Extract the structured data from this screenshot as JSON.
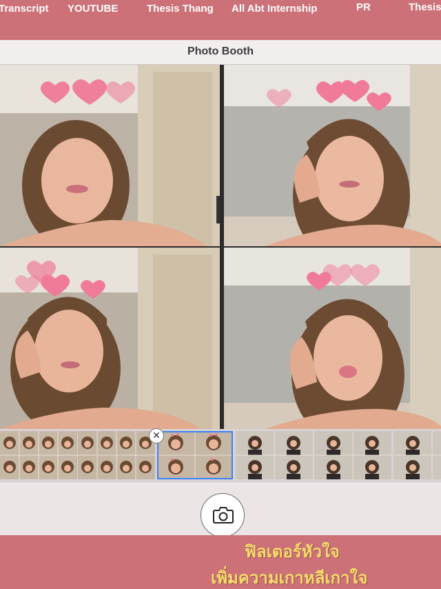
{
  "bookmarks": [
    "Transcript",
    "YOUTUBE",
    "Thesis Thang",
    "All Abt Internship",
    "PR",
    "Thesis"
  ],
  "window": {
    "title": "Photo Booth"
  },
  "photos": [
    {
      "effect": "hearts-filter"
    },
    {
      "effect": "hearts-filter"
    },
    {
      "effect": "hearts-filter"
    },
    {
      "effect": "hearts-filter"
    }
  ],
  "filmstrip": {
    "selected_index": 4,
    "thumbnail_count": 10,
    "close_glyph": "✕"
  },
  "controls": {
    "shutter_icon": "camera-icon"
  },
  "caption": {
    "line1": "ฟิลเตอร์หัวใจ",
    "line2": "เพิ่มความเกาหลีเกาใจ"
  },
  "colors": {
    "bar": "#cc7178",
    "caption_text": "#f4dd6a",
    "selection": "#3b82f6",
    "heart": "#f07a98"
  }
}
